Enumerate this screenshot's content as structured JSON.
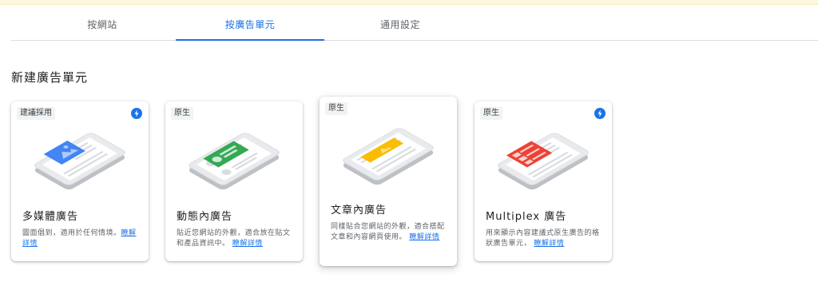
{
  "tabs": [
    {
      "label": "按網站",
      "active": false
    },
    {
      "label": "按廣告單元",
      "active": true
    },
    {
      "label": "通用設定",
      "active": false
    }
  ],
  "section_title": "新建廣告單元",
  "learn_more": "瞭解詳情",
  "cards": [
    {
      "tag": "建議採用",
      "bolt": true,
      "title": "多媒體廣告",
      "desc": "圖面倡到，適用於任何情境。",
      "ad_color": "#4285f4",
      "icon": "image-icon"
    },
    {
      "tag": "原生",
      "bolt": false,
      "title": "動態內廣告",
      "desc": "貼近您網站的外觀，適合放在貼文和產品資訊中。",
      "ad_color": "#34a853",
      "icon": "list-icon"
    },
    {
      "tag": "原生",
      "bolt": false,
      "title": "文章內廣告",
      "desc": "同樣貼合您網站的外觀，適合搭配文章和內容網頁使用。",
      "ad_color": "#fbbc04",
      "icon": "image-icon"
    },
    {
      "tag": "原生",
      "bolt": true,
      "title": "Multiplex 廣告",
      "desc": "用來顯示內容建議式原生廣告的格狀廣告單元，",
      "ad_color": "#ea4335",
      "icon": "grid-icon"
    }
  ]
}
